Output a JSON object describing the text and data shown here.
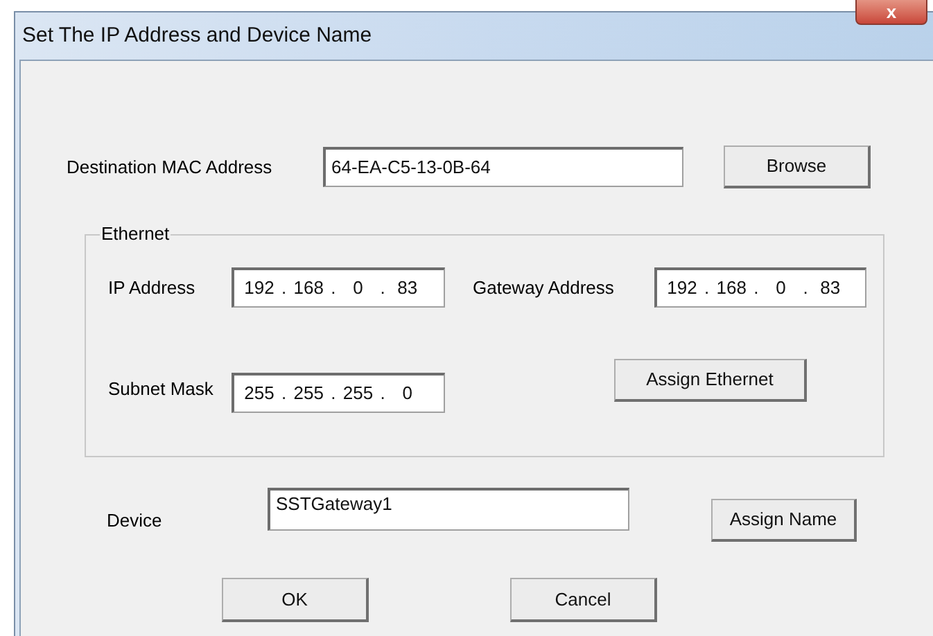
{
  "window": {
    "title": "Set The IP Address and Device Name",
    "close": "x"
  },
  "mac": {
    "label": "Destination MAC Address",
    "value": "64-EA-C5-13-0B-64",
    "button": "Browse"
  },
  "ethernet": {
    "legend": "Ethernet",
    "ip": {
      "label": "IP Address",
      "octets": [
        "192",
        "168",
        "0",
        "83"
      ],
      "separator": "."
    },
    "gateway": {
      "label": "Gateway Address",
      "octets": [
        "192",
        "168",
        "0",
        "83"
      ],
      "separator": "."
    },
    "subnet": {
      "label": "Subnet Mask",
      "octets": [
        "255",
        "255",
        "255",
        "0"
      ],
      "separator": "."
    },
    "button": "Assign Ethernet"
  },
  "device": {
    "label": "Device",
    "value": "SSTGateway1",
    "button": "Assign Name"
  },
  "buttons": [
    "OK",
    "Cancel"
  ]
}
